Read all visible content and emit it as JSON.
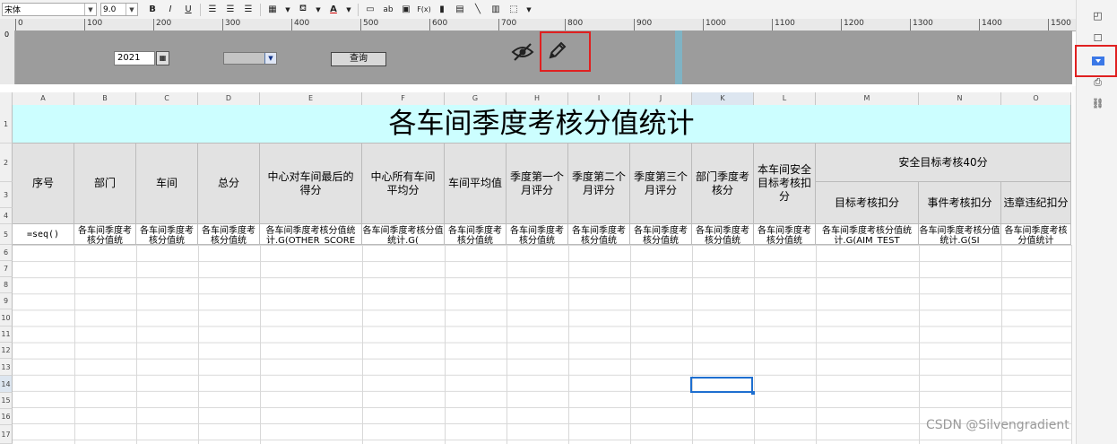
{
  "toolbar": {
    "font_name": "宋体",
    "font_size": "9.0",
    "bold": "B",
    "italic": "I",
    "underline": "U",
    "abc_label": "ab",
    "fx_label": "F(x)",
    "text_color_label": "A"
  },
  "ruler": {
    "marks": [
      "0",
      "100",
      "200",
      "300",
      "400",
      "500",
      "600",
      "700",
      "800",
      "900",
      "1000",
      "1100",
      "1200",
      "1300",
      "1400",
      "1500"
    ],
    "vertical_mark": "0"
  },
  "param_panel": {
    "year_value": "2021",
    "query_button": "查询"
  },
  "columns": [
    "A",
    "B",
    "C",
    "D",
    "E",
    "F",
    "G",
    "H",
    "I",
    "J",
    "K",
    "L",
    "M",
    "N",
    "O"
  ],
  "rows": [
    "1",
    "2",
    "3",
    "4",
    "5",
    "6",
    "7",
    "8",
    "9",
    "10",
    "11",
    "12",
    "13",
    "14",
    "15",
    "16",
    "17"
  ],
  "sheet": {
    "title": "各车间季度考核分值统计",
    "headers": {
      "seq": "序号",
      "dept": "部门",
      "workshop": "车间",
      "total": "总分",
      "center_final": "中心对车间最后的得分",
      "center_avg": "中心所有车间平均分",
      "ws_avg": "车间平均值",
      "q1": "季度第一个月评分",
      "q2": "季度第二个月评分",
      "q3": "季度第三个月评分",
      "dept_q": "部门季度考核分",
      "safety_deduct": "本车间安全目标考核扣分",
      "safety_group": "安全目标考核40分",
      "target_deduct": "目标考核扣分",
      "event_deduct": "事件考核扣分",
      "violation_deduct": "违章违纪扣分"
    },
    "row5": {
      "a": "=seq()",
      "b": "各车间季度考核分值统",
      "c": "各车间季度考核分值统",
      "d": "各车间季度考核分值统",
      "e": "各车间季度考核分值统计.G(OTHER_SCORE",
      "f": "各车间季度考核分值统计.G(",
      "g": "各车间季度考核分值统",
      "h": "各车间季度考核分值统",
      "i": "各车间季度考核分值统",
      "j": "各车间季度考核分值统",
      "k": "各车间季度考核分值统",
      "l": "各车间季度考核分值统",
      "m": "各车间季度考核分值统计.G(AIM_TEST",
      "n": "各车间季度考核分值统计.G(SI",
      "o": "各车间季度考核分值统计"
    }
  },
  "watermark": "CSDN @Silvengradient",
  "colors": {
    "title_bg": "#ccfeff",
    "header_bg": "#e2e2e2",
    "param_bg": "#9c9c9c",
    "highlight_red": "#e02020",
    "selection_blue": "#1e6fd0"
  }
}
